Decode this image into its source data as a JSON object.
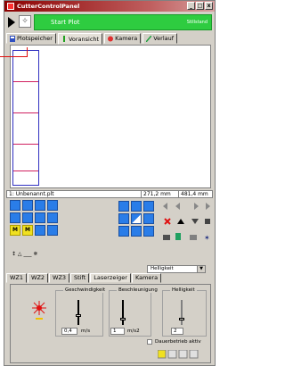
{
  "window": {
    "title": "CutterControlPanel",
    "min": "_",
    "max": "□",
    "close": "x"
  },
  "toolbar": {
    "start_label": "Start Plot",
    "status": "Stillstand"
  },
  "tabs_top": [
    {
      "label": "Plotspeicher",
      "icon": "save-icon"
    },
    {
      "label": "Voransicht",
      "icon": "preview-icon"
    },
    {
      "label": "Kamera",
      "icon": "camera-icon"
    },
    {
      "label": "Verlauf",
      "icon": "pen-icon"
    }
  ],
  "infobar": {
    "file": "1: Unbenannt.plt",
    "dim1": "271,2 mm",
    "dim2": "481,4 mm"
  },
  "controls": {
    "m_label_1": "M",
    "m_label_2": "M",
    "misc_label": "↕ △ ___ ✵"
  },
  "tabs_bottom": [
    "WZ1",
    "WZ2",
    "WZ3",
    "Stift",
    "Laserzeiger",
    "Kamera"
  ],
  "laser": {
    "mode_select": "Helligkeit",
    "group1_label": "Geschwindigkeit",
    "group2_label": "Beschleunigung",
    "group3_label": "Helligkeit",
    "speed_value": "0,4",
    "speed_unit": "m/s",
    "accel_value": "1",
    "accel_unit": "m/s2",
    "bright_value": "2",
    "checkbox_label": "Dauerbetrieb aktiv"
  },
  "colors": {
    "accent_green": "#2ecc40",
    "button_blue": "#2a7de8",
    "laser_red": "#e01010"
  }
}
